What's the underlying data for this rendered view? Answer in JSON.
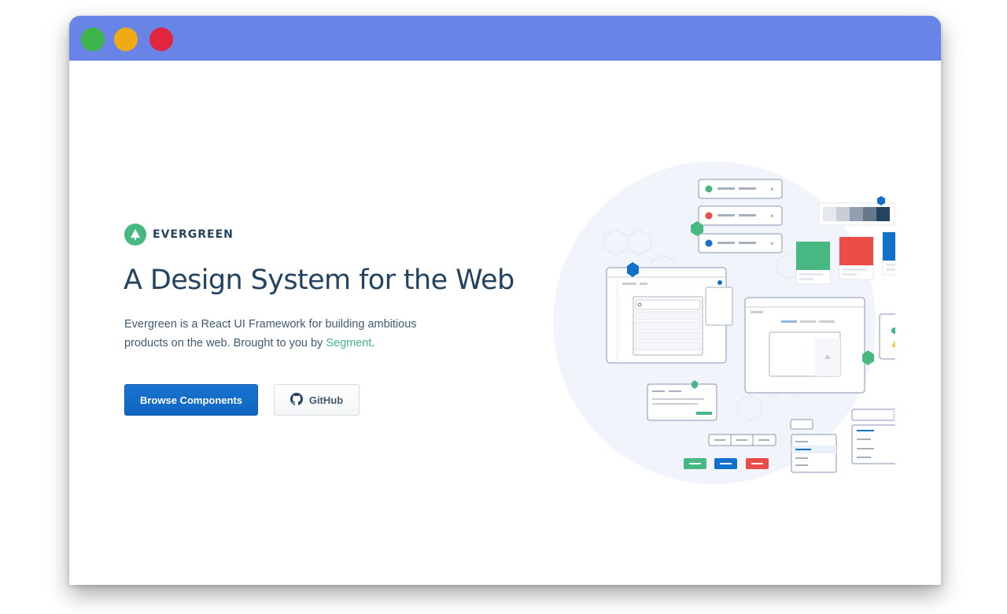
{
  "window": {
    "controls": [
      "green-dot",
      "yellow-dot",
      "red-dot"
    ]
  },
  "brand": {
    "name": "EVERGREEN",
    "logo_icon": "evergreen-tree-icon"
  },
  "hero": {
    "headline": "A Design System for the Web",
    "description_before": "Evergreen is a React UI Framework for building ambitious products on the web. Brought to you by ",
    "description_link": "Segment",
    "description_after": "."
  },
  "buttons": {
    "primary_label": "Browse Components",
    "secondary_label": "GitHub",
    "secondary_icon": "github-icon"
  },
  "illustration": {
    "typography_sample": "Aa",
    "swatches": [
      "#47b881",
      "#ec4c47",
      "#1070ca"
    ],
    "grays": [
      "#e4e7eb",
      "#c7ced4",
      "#90a0b0",
      "#66788a",
      "#234361"
    ]
  },
  "colors": {
    "brand_green": "#47b881",
    "ink": "#234361",
    "primary_blue": "#1070ca",
    "titlebar": "#6784e6"
  }
}
